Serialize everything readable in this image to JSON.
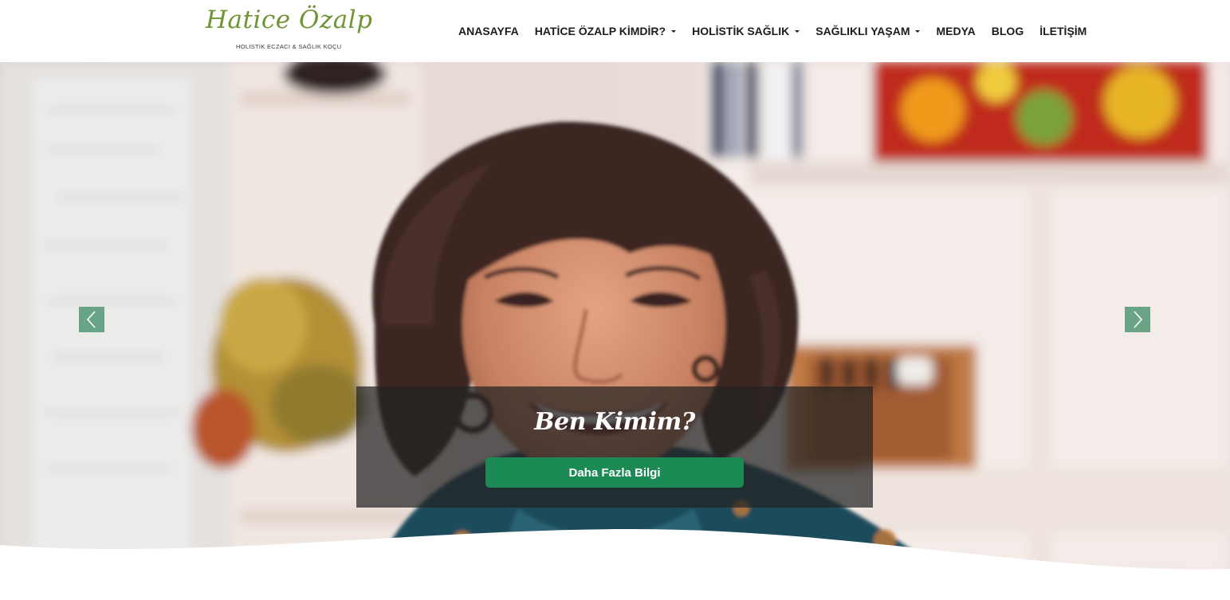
{
  "header": {
    "logo": {
      "name": "Hatice Özalp",
      "tagline": "HOLİSTİK ECZACI & SAĞLIK KOÇU"
    },
    "nav": [
      {
        "label": "ANASAYFA",
        "has_dropdown": false
      },
      {
        "label": "HATİCE ÖZALP KİMDİR?",
        "has_dropdown": true
      },
      {
        "label": "HOLİSTİK SAĞLIK",
        "has_dropdown": true
      },
      {
        "label": "SAĞLIKLI YAŞAM",
        "has_dropdown": true
      },
      {
        "label": "MEDYA",
        "has_dropdown": false
      },
      {
        "label": "BLOG",
        "has_dropdown": false
      },
      {
        "label": "İLETİŞİM",
        "has_dropdown": false
      }
    ]
  },
  "hero": {
    "caption_title": "Ben Kimim?",
    "cta_label": "Daha Fazla Bilgi",
    "prev_icon": "chevron-left-icon",
    "next_icon": "chevron-right-icon"
  },
  "colors": {
    "logo_green": "#6f9433",
    "cta_green": "#1b8a54",
    "arrow_bg": "#3c8c64",
    "caption_bg": "#232323"
  }
}
